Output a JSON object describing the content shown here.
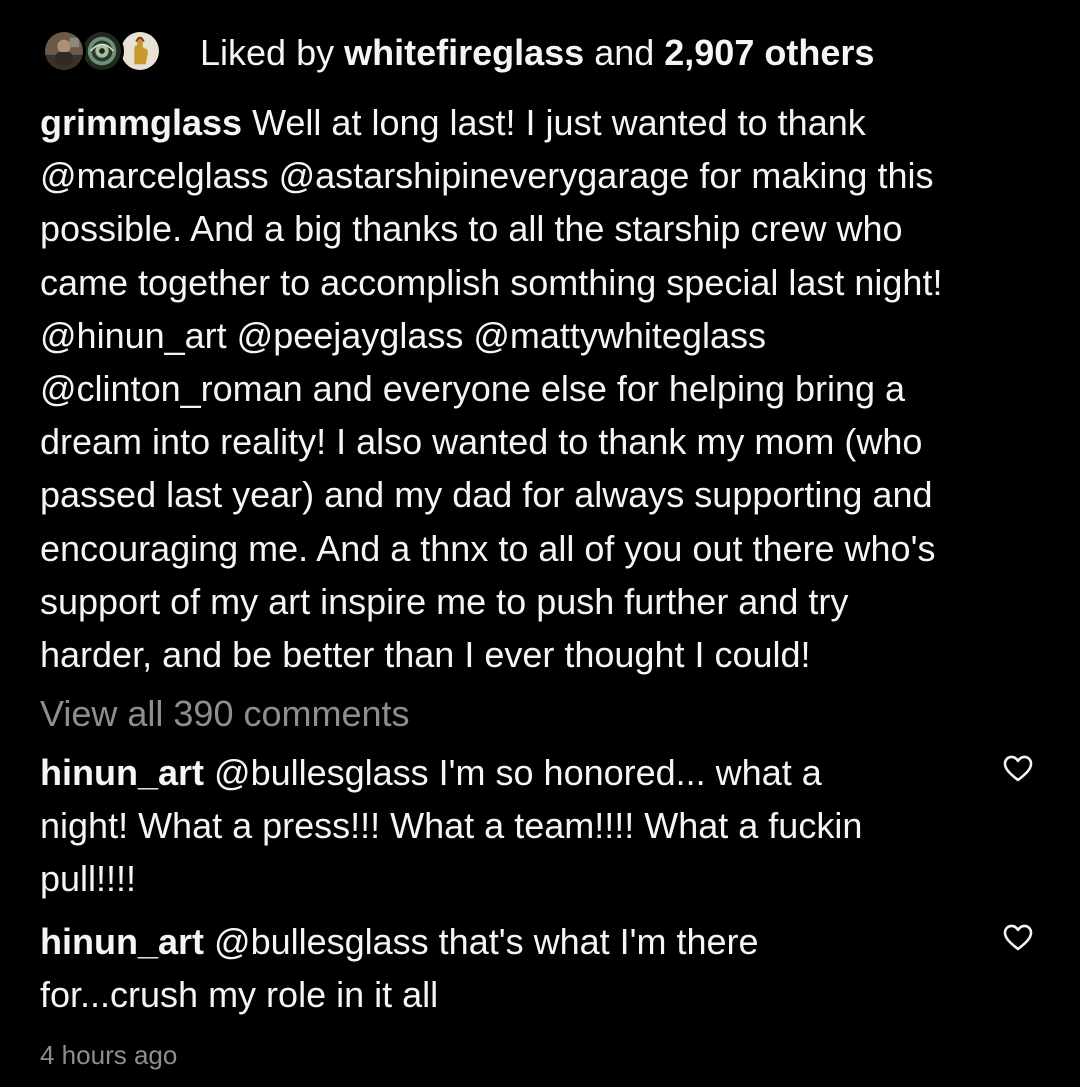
{
  "likes": {
    "prefix": "Liked by ",
    "user": "whitefireglass",
    "middle": " and ",
    "count": "2,907 others",
    "avatars": [
      "avatar-person-icon",
      "avatar-spiral-glass-icon",
      "avatar-hand-icon"
    ]
  },
  "caption": {
    "username": "grimmglass",
    "lines": [
      " Well at long last! I just wanted to thank",
      "@marcelglass @astarshipineverygarage  for making this",
      "possible.  And a big thanks to all the starship crew who",
      "came together to accomplish somthing special last night!",
      "@hinun_art @peejayglass @mattywhiteglass",
      "@clinton_roman and everyone else for helping bring a",
      "dream into reality! I also wanted to thank my mom (who",
      "passed last year) and my dad for always supporting and",
      "encouraging me.  And a thnx to all of you out there who's",
      "support of my art inspire me to push further and try",
      "harder, and be better than I ever thought I could!"
    ]
  },
  "view_all_comments": "View all 390 comments",
  "comments": [
    {
      "username": "hinun_art",
      "lines": [
        " @bullesglass I'm so honored... what a",
        "night! What a press!!! What a team!!!! What a fuckin",
        "pull!!!!"
      ],
      "like_icon": "heart-outline-icon"
    },
    {
      "username": "hinun_art",
      "lines": [
        " @bullesglass that's what I'm there",
        "for...crush my role in it all"
      ],
      "like_icon": "heart-outline-icon"
    }
  ],
  "timestamp": "4 hours ago",
  "colors": {
    "background": "#000000",
    "text": "#f5f5f5",
    "secondary_text": "#8e8e8e"
  }
}
